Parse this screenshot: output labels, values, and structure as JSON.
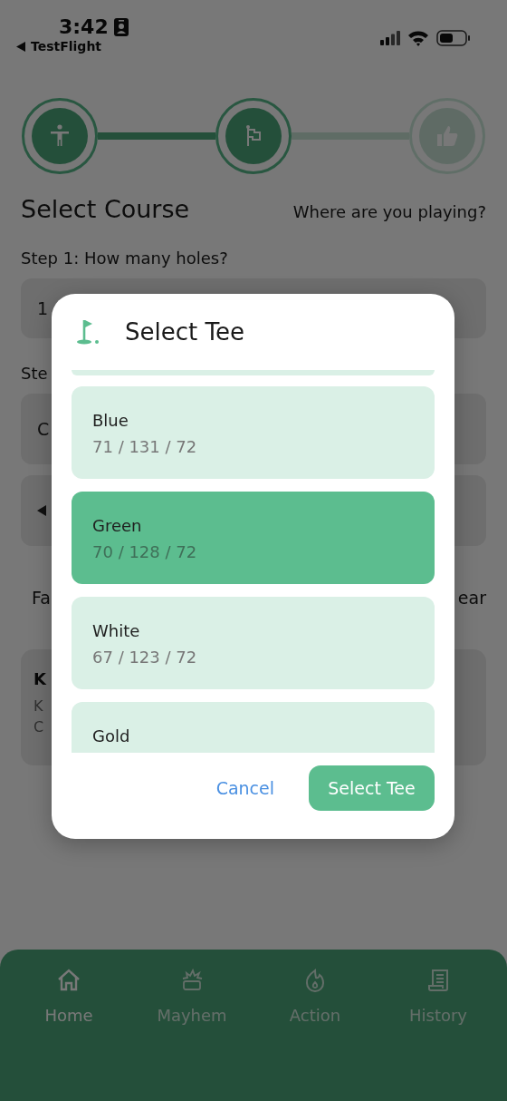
{
  "status_bar": {
    "time": "3:42",
    "back_label": "TestFlight"
  },
  "stepper": [
    {
      "active": true
    },
    {
      "active": true
    },
    {
      "active": false
    }
  ],
  "page": {
    "title": "Select Course",
    "subtitle": "Where are you playing?",
    "step1_label": "Step 1: How many holes?",
    "holes_field": "1",
    "step2_label": "Ste",
    "course_field": "C",
    "tabs_left": "Fa",
    "tabs_right": "ear",
    "course_card": {
      "title": "K",
      "line_1": "K",
      "line_2": "C"
    }
  },
  "dialog": {
    "title": "Select Tee",
    "tees": [
      {
        "kind": "cut",
        "selected": false
      },
      {
        "kind": "tee",
        "name": "Blue",
        "stats": "71 / 131 / 72",
        "selected": false
      },
      {
        "kind": "tee",
        "name": "Green",
        "stats": "70 / 128 / 72",
        "selected": true
      },
      {
        "kind": "tee",
        "name": "White",
        "stats": "67 / 123 / 72",
        "selected": false
      },
      {
        "kind": "tee",
        "name": "Gold",
        "selected": false
      }
    ],
    "cancel": "Cancel",
    "confirm": "Select Tee"
  },
  "nav": [
    {
      "label": "Home",
      "selected": true
    },
    {
      "label": "Mayhem",
      "selected": false
    },
    {
      "label": "Action",
      "selected": false
    },
    {
      "label": "History",
      "selected": false
    }
  ]
}
